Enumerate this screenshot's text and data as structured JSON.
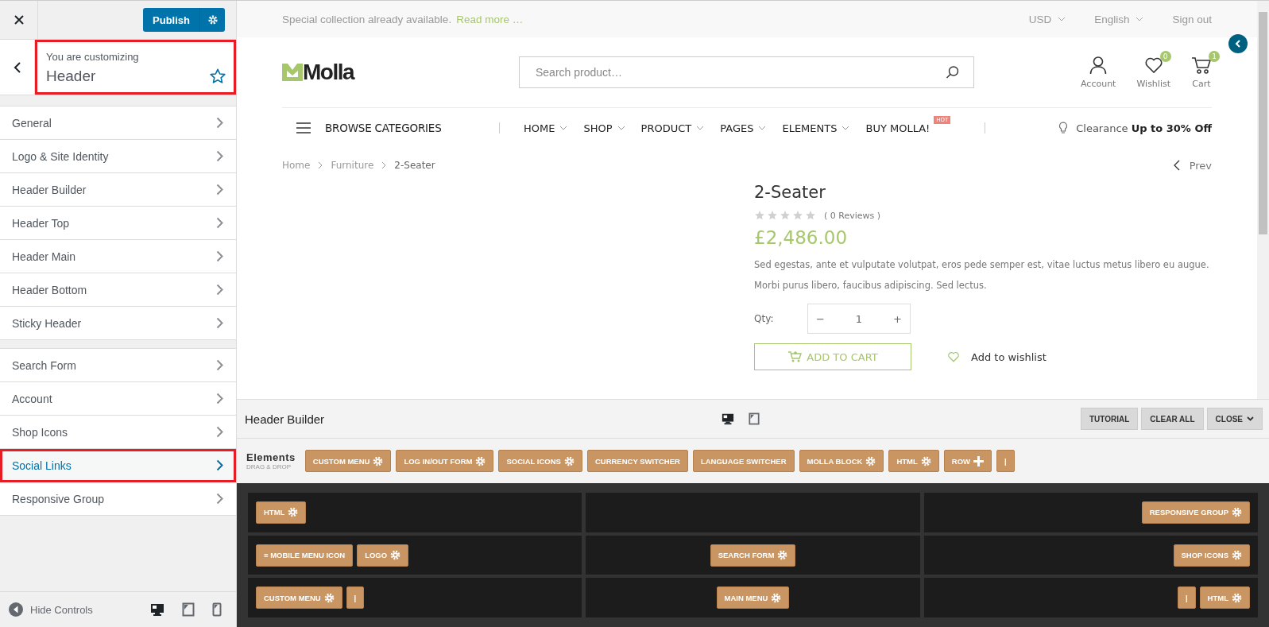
{
  "sidebar": {
    "publish_button": "Publish",
    "customizing": {
      "label": "You are customizing",
      "title": "Header",
      "highlighted": true
    },
    "groups": [
      [
        {
          "label": "General",
          "selected": false,
          "highlighted": false
        },
        {
          "label": "Logo & Site Identity",
          "selected": false,
          "highlighted": false
        },
        {
          "label": "Header Builder",
          "selected": false,
          "highlighted": false
        },
        {
          "label": "Header Top",
          "selected": false,
          "highlighted": false
        },
        {
          "label": "Header Main",
          "selected": false,
          "highlighted": false
        },
        {
          "label": "Header Bottom",
          "selected": false,
          "highlighted": false
        },
        {
          "label": "Sticky Header",
          "selected": false,
          "highlighted": false
        }
      ],
      [
        {
          "label": "Search Form",
          "selected": false,
          "highlighted": false
        },
        {
          "label": "Account",
          "selected": false,
          "highlighted": false
        },
        {
          "label": "Shop Icons",
          "selected": false,
          "highlighted": false
        },
        {
          "label": "Social Links",
          "selected": true,
          "highlighted": true
        },
        {
          "label": "Responsive Group",
          "selected": false,
          "highlighted": false
        }
      ]
    ],
    "hide_controls": "Hide Controls",
    "devices": [
      {
        "kind": "desktop",
        "selected": true
      },
      {
        "kind": "tablet",
        "selected": false
      },
      {
        "kind": "mobile",
        "selected": false
      }
    ]
  },
  "preview": {
    "topbar": {
      "notice": "Special collection already available.",
      "link": "Read more …",
      "currency": "USD",
      "language": "English",
      "sign_out": "Sign out"
    },
    "logo": "Molla",
    "search": {
      "placeholder": "Search product…"
    },
    "header_icons": [
      {
        "kind": "account",
        "label": "Account"
      },
      {
        "kind": "wishlist",
        "label": "Wishlist",
        "badge": "0"
      },
      {
        "kind": "cart",
        "label": "Cart",
        "badge": "1"
      }
    ],
    "browse": "BROWSE CATEGORIES",
    "nav": [
      {
        "label": "HOME",
        "dropdown": true
      },
      {
        "label": "SHOP",
        "dropdown": true
      },
      {
        "label": "PRODUCT",
        "dropdown": true
      },
      {
        "label": "PAGES",
        "dropdown": true
      },
      {
        "label": "ELEMENTS",
        "dropdown": true
      },
      {
        "label": "BUY MOLLA!",
        "dropdown": false,
        "badge": "HOT"
      }
    ],
    "promo": {
      "prefix": "Clearance",
      "highlight": "Up to 30% Off"
    },
    "breadcrumb": [
      "Home",
      "Furniture",
      "2-Seater"
    ],
    "prev": "Prev",
    "product": {
      "title": "2-Seater",
      "stars": 0,
      "reviews": "( 0 Reviews )",
      "price": "£2,486.00",
      "description": "Sed egestas, ante et vulputate volutpat, eros pede semper est, vitae luctus metus libero eu augue. Morbi purus libero, faucibus adipiscing. Sed lectus.",
      "qty_label": "Qty:",
      "qty_minus": "−",
      "qty_value": "1",
      "qty_plus": "+",
      "add_to_cart": "ADD TO CART",
      "wishlist": "Add to wishlist"
    }
  },
  "builder": {
    "title": "Header Builder",
    "devices": [
      {
        "kind": "desktop",
        "selected": true
      },
      {
        "kind": "tablet",
        "selected": false
      }
    ],
    "buttons": [
      "TUTORIAL",
      "CLEAR ALL",
      "CLOSE"
    ],
    "elements_label": "Elements",
    "elements_hint": "DRAG & DROP",
    "elements": [
      {
        "label": "CUSTOM MENU",
        "kind": "gear"
      },
      {
        "label": "LOG IN/OUT FORM",
        "kind": "gear"
      },
      {
        "label": "SOCIAL ICONS",
        "kind": "gear"
      },
      {
        "label": "CURRENCY SWITCHER",
        "kind": "plain"
      },
      {
        "label": "LANGUAGE SWITCHER",
        "kind": "plain"
      },
      {
        "label": "MOLLA BLOCK",
        "kind": "gear"
      },
      {
        "label": "HTML",
        "kind": "gear"
      },
      {
        "label": "ROW",
        "kind": "plus"
      },
      {
        "label": "|",
        "kind": "plain"
      }
    ],
    "rows": [
      [
        [
          {
            "label": "HTML",
            "kind": "gear"
          }
        ],
        [],
        [
          {
            "label": "RESPONSIVE GROUP",
            "kind": "gear"
          }
        ]
      ],
      [
        [
          {
            "label": "≡ MOBILE MENU ICON",
            "kind": "plain"
          },
          {
            "label": "LOGO",
            "kind": "gear"
          }
        ],
        [
          {
            "label": "SEARCH FORM",
            "kind": "gear"
          }
        ],
        [
          {
            "label": "SHOP ICONS",
            "kind": "gear"
          }
        ]
      ],
      [
        [
          {
            "label": "CUSTOM MENU",
            "kind": "gear"
          },
          {
            "label": "|",
            "kind": "plain"
          }
        ],
        [
          {
            "label": "MAIN MENU",
            "kind": "gear"
          }
        ],
        [
          {
            "label": "|",
            "kind": "plain"
          },
          {
            "label": "HTML",
            "kind": "gear"
          }
        ]
      ]
    ]
  }
}
